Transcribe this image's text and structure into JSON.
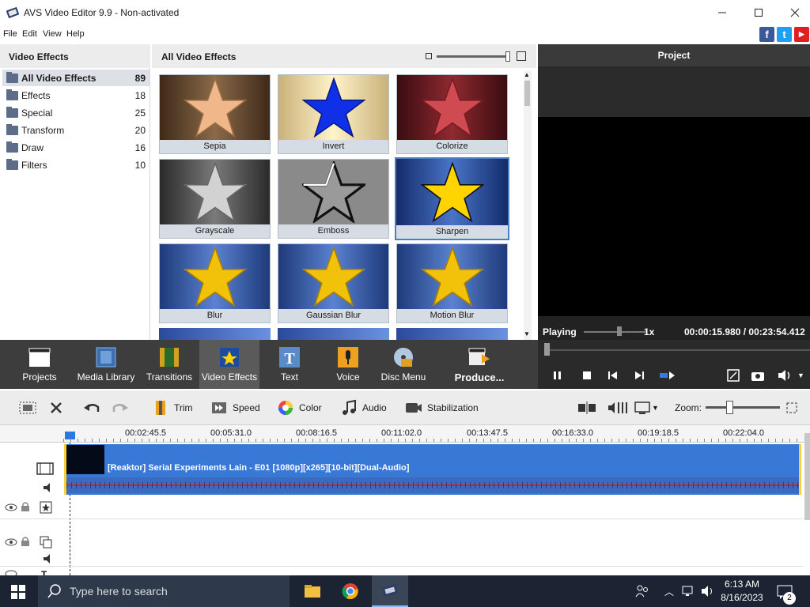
{
  "window": {
    "title": "AVS Video Editor 9.9 - Non-activated"
  },
  "menu": [
    "File",
    "Edit",
    "View",
    "Help"
  ],
  "social": {
    "facebook": "f",
    "twitter": "t",
    "youtube": "▶"
  },
  "categories": {
    "header": "Video Effects",
    "items": [
      {
        "label": "All Video Effects",
        "count": "89"
      },
      {
        "label": "Effects",
        "count": "18"
      },
      {
        "label": "Special",
        "count": "25"
      },
      {
        "label": "Transform",
        "count": "20"
      },
      {
        "label": "Draw",
        "count": "16"
      },
      {
        "label": "Filters",
        "count": "10"
      }
    ]
  },
  "effects": {
    "header": "All Video Effects",
    "items": [
      "Sepia",
      "Invert",
      "Colorize",
      "Grayscale",
      "Emboss",
      "Sharpen",
      "Blur",
      "Gaussian Blur",
      "Motion Blur"
    ],
    "selected": "Sharpen"
  },
  "project": {
    "header": "Project",
    "status": "Playing",
    "speed": "1x",
    "time_current": "00:00:15.980",
    "time_sep": "/",
    "time_total": "00:23:54.412"
  },
  "main_tools": [
    {
      "label": "Projects"
    },
    {
      "label": "Media Library"
    },
    {
      "label": "Transitions"
    },
    {
      "label": "Video Effects"
    },
    {
      "label": "Text"
    },
    {
      "label": "Voice"
    },
    {
      "label": "Disc Menu"
    },
    {
      "label": "Produce..."
    }
  ],
  "edit_tools": {
    "trim": "Trim",
    "speed": "Speed",
    "color": "Color",
    "audio": "Audio",
    "stabilization": "Stabilization",
    "zoom": "Zoom:"
  },
  "ruler": [
    "00:02:45.5",
    "00:05:31.0",
    "00:08:16.5",
    "00:11:02.0",
    "00:13:47.5",
    "00:16:33.0",
    "00:19:18.5",
    "00:22:04.0"
  ],
  "clip": {
    "title": "[Reaktor] Serial Experiments Lain - E01 [1080p][x265][10-bit][Dual-Audio]"
  },
  "taskbar": {
    "search_placeholder": "Type here to search",
    "time": "6:13 AM",
    "date": "8/16/2023",
    "notif_count": "2"
  }
}
